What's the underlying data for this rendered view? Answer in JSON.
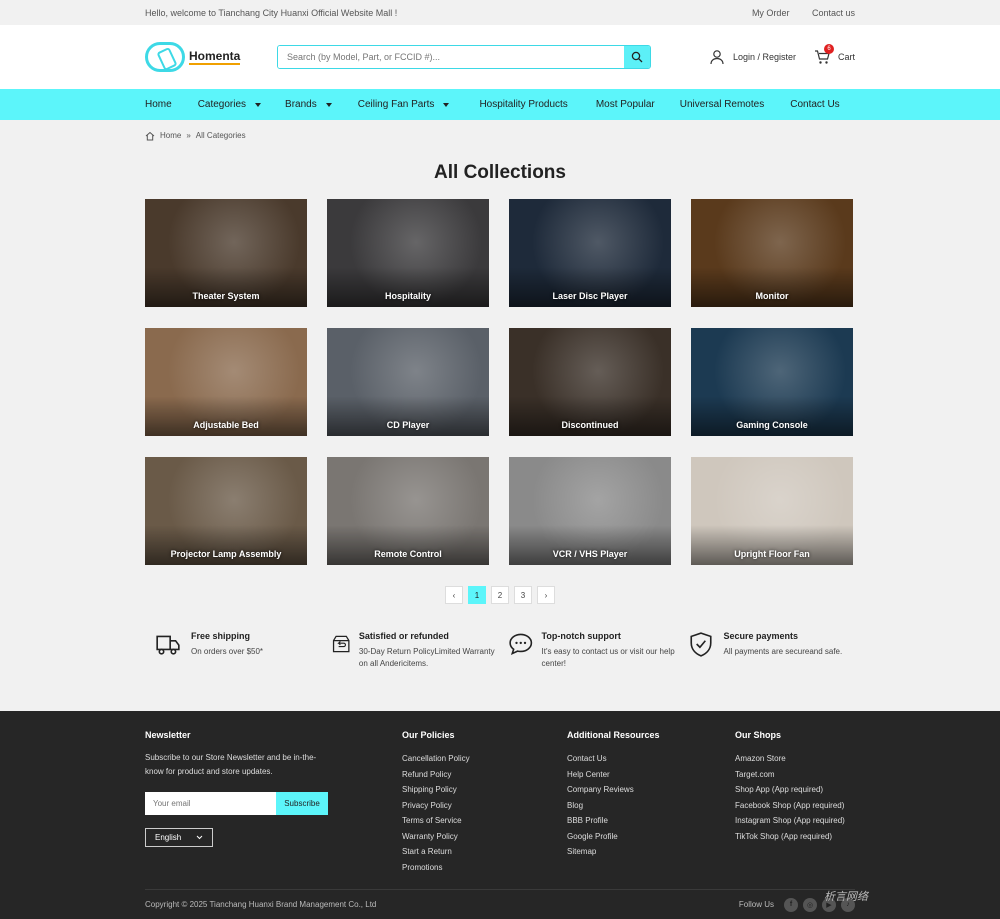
{
  "topbar": {
    "welcome": "Hello, welcome to Tianchang City Huanxi Official Website Mall !",
    "my_order": "My Order",
    "contact": "Contact us"
  },
  "header": {
    "logo": "Homenta",
    "search_placeholder": "Search (by Model, Part, or FCCID #)...",
    "login": "Login / Register",
    "cart": "Cart",
    "cart_count": "6"
  },
  "nav": [
    {
      "label": "Home",
      "caret": false
    },
    {
      "label": "Categories",
      "caret": true
    },
    {
      "label": "Brands",
      "caret": true
    },
    {
      "label": "Ceiling Fan Parts",
      "caret": true
    },
    {
      "label": "Hospitality Products",
      "caret": false
    },
    {
      "label": "Most Popular",
      "caret": false
    },
    {
      "label": "Universal Remotes",
      "caret": false
    },
    {
      "label": "Contact Us",
      "caret": false
    }
  ],
  "breadcrumb": {
    "home": "Home",
    "sep": "»",
    "current": "All Categories"
  },
  "title": "All Collections",
  "collections": [
    {
      "label": "Theater System",
      "color": "#4a3a2c"
    },
    {
      "label": "Hospitality",
      "color": "#3b3a3c"
    },
    {
      "label": "Laser Disc Player",
      "color": "#1e2a3a"
    },
    {
      "label": "Monitor",
      "color": "#5a3a1c"
    },
    {
      "label": "Adjustable Bed",
      "color": "#8a6a4e"
    },
    {
      "label": "CD Player",
      "color": "#5a6068"
    },
    {
      "label": "Discontinued",
      "color": "#3a3028"
    },
    {
      "label": "Gaming Console",
      "color": "#1c3a52"
    },
    {
      "label": "Projector Lamp Assembly",
      "color": "#6a5a48"
    },
    {
      "label": "Remote Control",
      "color": "#7a7672"
    },
    {
      "label": "VCR / VHS Player",
      "color": "#8a8a8a"
    },
    {
      "label": "Upright Floor Fan",
      "color": "#cfc7bd"
    }
  ],
  "pagination": [
    "1",
    "2",
    "3"
  ],
  "features": [
    {
      "title": "Free shipping",
      "desc": "On orders over $50*",
      "icon": "truck-icon"
    },
    {
      "title": "Satisfied or refunded",
      "desc": "30-Day Return PolicyLimited Warranty on all Andericitems.",
      "icon": "return-box-icon"
    },
    {
      "title": "Top-notch support",
      "desc": "It's easy to contact us or visit our help center!",
      "icon": "chat-icon"
    },
    {
      "title": "Secure payments",
      "desc": "All payments are secureand safe.",
      "icon": "shield-icon"
    }
  ],
  "footer": {
    "newsletter": {
      "title": "Newsletter",
      "text": "Subscribe to our Store Newsletter and be in-the-know for product and store updates.",
      "placeholder": "Your email",
      "button": "Subscribe",
      "language": "English"
    },
    "policies": {
      "title": "Our Policies",
      "links": [
        "Cancellation Policy",
        "Refund Policy",
        "Shipping Policy",
        "Privacy Policy",
        "Terms of Service",
        "Warranty Policy",
        "Start a Return",
        "Promotions"
      ]
    },
    "resources": {
      "title": "Additional Resources",
      "links": [
        "Contact Us",
        "Help Center",
        "Company Reviews",
        "Blog",
        "BBB Profile",
        "Google Profile",
        "Sitemap"
      ]
    },
    "shops": {
      "title": "Our Shops",
      "links": [
        "Amazon Store",
        "Target.com",
        "Shop App (App required)",
        "Facebook Shop (App required)",
        "Instagram Shop (App required)",
        "TikTok Shop (App required)"
      ]
    },
    "copyright": "Copyright © 2025 Tianchang Huanxi Brand Management Co., Ltd",
    "follow": "Follow Us"
  },
  "watermark": "析言网络"
}
